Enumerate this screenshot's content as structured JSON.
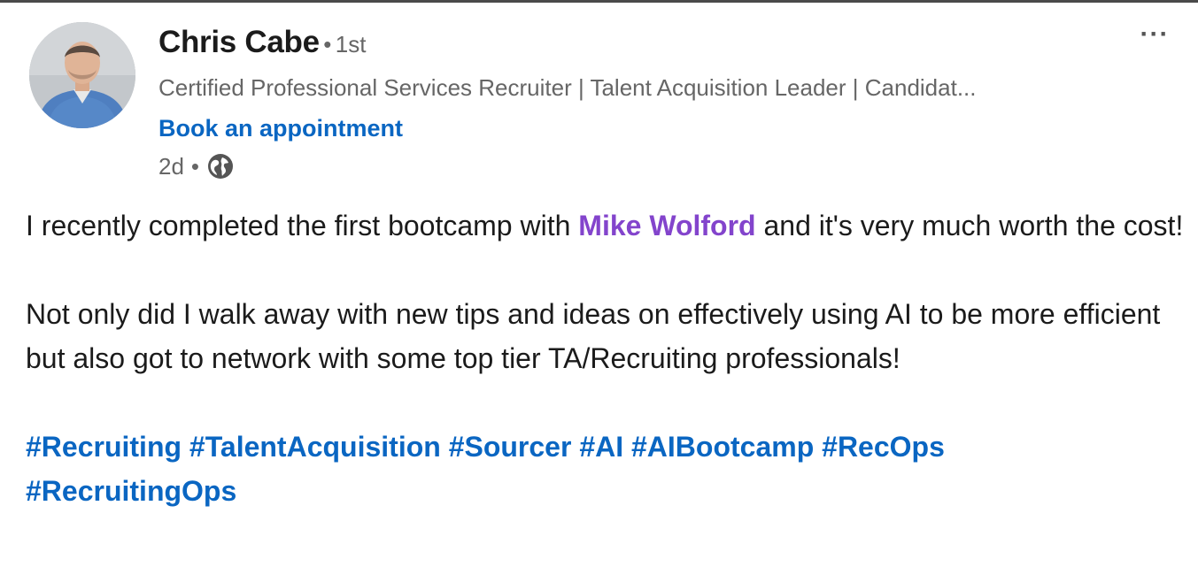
{
  "post": {
    "author": {
      "name": "Chris Cabe",
      "degree_separator": "•",
      "degree": "1st",
      "headline": "Certified Professional Services Recruiter | Talent Acquisition Leader | Candidat...",
      "cta_label": "Book an appointment"
    },
    "meta": {
      "age": "2d",
      "separator": "•",
      "visibility_icon": "globe-icon"
    },
    "menu_icon": "more-options-icon",
    "menu_glyph": "···",
    "body": {
      "p1_before": "I recently completed the first bootcamp with ",
      "mention": "Mike Wolford",
      "p1_after": " and it's very much worth the cost!",
      "p2": "Not only did I walk away with new tips and ideas on effectively using AI to be more efficient but also got to network with some top tier TA/Recruiting professionals!",
      "hashtags": [
        "#Recruiting",
        "#TalentAcquisition",
        "#Sourcer",
        "#AI",
        "#AIBootcamp",
        "#RecOps",
        "#RecruitingOps"
      ]
    }
  },
  "colors": {
    "link_blue": "#0a66c2",
    "mention_purple": "#8344cc",
    "text_dark": "#1b1b1b",
    "text_muted": "#666666"
  }
}
